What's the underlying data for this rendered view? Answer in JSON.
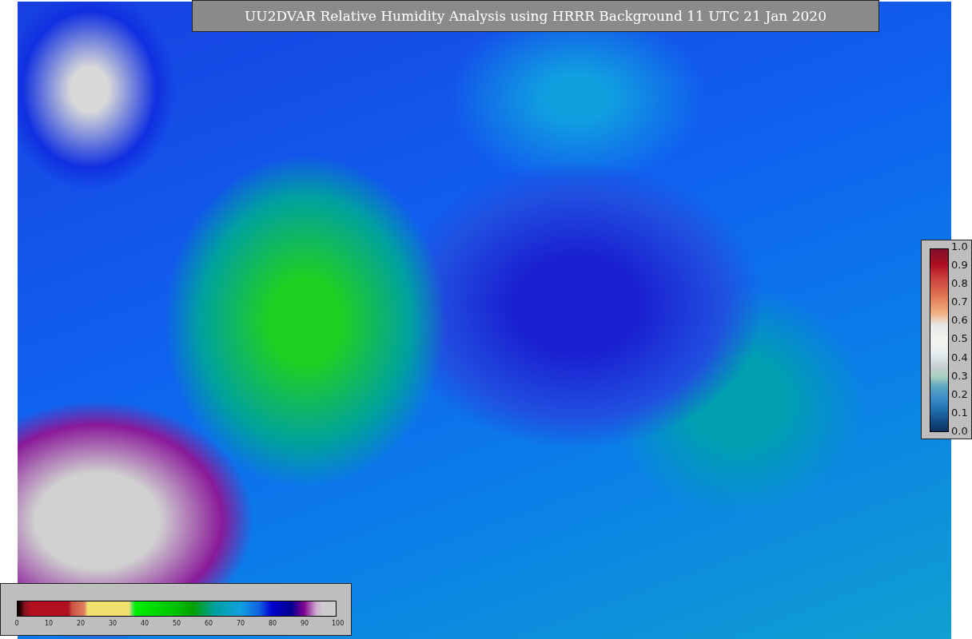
{
  "title": "UU2DVAR Relative Humidity Analysis using HRRR Background 11 UTC 21 Jan 2020",
  "humidity_colorbar": {
    "ticks": [
      "0",
      "10",
      "20",
      "30",
      "40",
      "50",
      "60",
      "70",
      "80",
      "90",
      "100"
    ]
  },
  "observation_colorbar": {
    "ticks": [
      "1.0",
      "0.9",
      "0.8",
      "0.7",
      "0.6",
      "0.5",
      "0.4",
      "0.3",
      "0.2",
      "0.1",
      "0.0"
    ]
  }
}
